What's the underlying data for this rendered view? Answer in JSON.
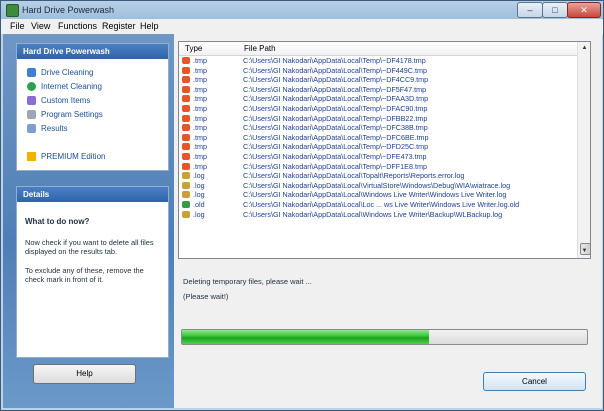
{
  "window": {
    "title": "Hard Drive Powerwash",
    "controls": {
      "minimize": "–",
      "maximize": "□",
      "close": "✕"
    }
  },
  "menu": [
    "File",
    "View",
    "Functions",
    "Register",
    "Help"
  ],
  "sidebar": {
    "panel_title": "Hard Drive Powerwash",
    "items": [
      {
        "label": "Drive Cleaning",
        "icon": "drive-icon",
        "color": "#3f7ed1"
      },
      {
        "label": "Internet Cleaning",
        "icon": "globe-icon",
        "color": "#2aa24a"
      },
      {
        "label": "Custom Items",
        "icon": "custom-items-icon",
        "color": "#8c6bd6"
      },
      {
        "label": "Program Settings",
        "icon": "wrench-icon",
        "color": "#9aa7b7"
      },
      {
        "label": "Results",
        "icon": "document-icon",
        "color": "#7aa0cf"
      },
      {
        "label": "PREMIUM Edition",
        "icon": "lightning-icon",
        "color": "#f0b400"
      }
    ],
    "details": {
      "title": "Details",
      "heading": "What to do now?",
      "text1": "Now check if you want to delete all files displayed on the results tab.",
      "text2": "To exclude any of these, remove the check mark in front of it."
    },
    "help_button": "Help"
  },
  "file_list": {
    "columns": [
      "Type",
      "File Path"
    ],
    "rows": [
      {
        "type": ".tmp",
        "path": "C:\\Users\\GI Nakodari\\AppData\\Local\\Temp\\~DF4178.tmp",
        "icon": "tmp-file-icon"
      },
      {
        "type": ".tmp",
        "path": "C:\\Users\\GI Nakodari\\AppData\\Local\\Temp\\~DF449C.tmp",
        "icon": "tmp-file-icon"
      },
      {
        "type": ".tmp",
        "path": "C:\\Users\\GI Nakodari\\AppData\\Local\\Temp\\~DF4CC9.tmp",
        "icon": "tmp-file-icon"
      },
      {
        "type": ".tmp",
        "path": "C:\\Users\\GI Nakodari\\AppData\\Local\\Temp\\~DF5F47.tmp",
        "icon": "tmp-file-icon"
      },
      {
        "type": ".tmp",
        "path": "C:\\Users\\GI Nakodari\\AppData\\Local\\Temp\\~DFAA3D.tmp",
        "icon": "tmp-file-icon"
      },
      {
        "type": ".tmp",
        "path": "C:\\Users\\GI Nakodari\\AppData\\Local\\Temp\\~DFAC90.tmp",
        "icon": "tmp-file-icon"
      },
      {
        "type": ".tmp",
        "path": "C:\\Users\\GI Nakodari\\AppData\\Local\\Temp\\~DFBB22.tmp",
        "icon": "tmp-file-icon"
      },
      {
        "type": ".tmp",
        "path": "C:\\Users\\GI Nakodari\\AppData\\Local\\Temp\\~DFC38B.tmp",
        "icon": "tmp-file-icon"
      },
      {
        "type": ".tmp",
        "path": "C:\\Users\\GI Nakodari\\AppData\\Local\\Temp\\~DFC6BE.tmp",
        "icon": "tmp-file-icon"
      },
      {
        "type": ".tmp",
        "path": "C:\\Users\\GI Nakodari\\AppData\\Local\\Temp\\~DFD25C.tmp",
        "icon": "tmp-file-icon"
      },
      {
        "type": ".tmp",
        "path": "C:\\Users\\GI Nakodari\\AppData\\Local\\Temp\\~DFE473.tmp",
        "icon": "tmp-file-icon"
      },
      {
        "type": ".tmp",
        "path": "C:\\Users\\GI Nakodari\\AppData\\Local\\Temp\\~DFF1E8.tmp",
        "icon": "tmp-file-icon"
      },
      {
        "type": ".log",
        "path": "C:\\Users\\GI Nakodari\\AppData\\Local\\Topalt\\Reports\\Reports.error.log",
        "icon": "log-file-icon"
      },
      {
        "type": ".log",
        "path": "C:\\Users\\GI Nakodari\\AppData\\Local\\VirtualStore\\Windows\\Debug\\WIA\\wiatrace.log",
        "icon": "log-file-icon"
      },
      {
        "type": ".log",
        "path": "C:\\Users\\GI Nakodari\\AppData\\Local\\Windows Live Writer\\Windows Live Writer.log",
        "icon": "log-file-icon"
      },
      {
        "type": ".old",
        "path": "C:\\Users\\GI Nakodari\\AppData\\Local\\Loc ... ws Live Writer\\Windows Live Writer.log.old",
        "icon": "old-file-icon"
      },
      {
        "type": ".log",
        "path": "C:\\Users\\GI Nakodari\\AppData\\Local\\Windows Live Writer\\Backup\\WLBackup.log",
        "icon": "log-file-icon"
      }
    ]
  },
  "status": {
    "line1": "Deleting temporary files, please wait ...",
    "line2": "(Please wait!)"
  },
  "progress": {
    "fraction": 0.61
  },
  "cancel_button": "Cancel",
  "colors": {
    "path_text": "#1c3f9a",
    "progress_green": "#34c534",
    "panel_header": "#2f63aa",
    "tmp_icon": "#e8552a",
    "log_icon": "#c9a13a",
    "old_icon": "#3a9a48"
  }
}
